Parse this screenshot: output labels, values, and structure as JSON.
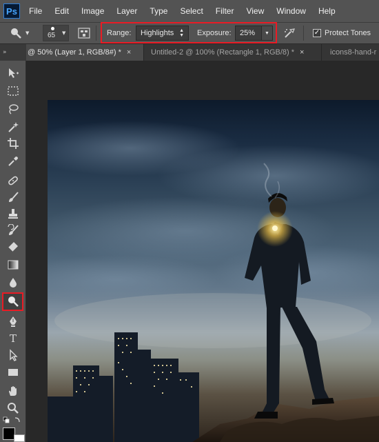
{
  "app": {
    "logo": "Ps"
  },
  "menu": [
    "File",
    "Edit",
    "Image",
    "Layer",
    "Type",
    "Select",
    "Filter",
    "View",
    "Window",
    "Help"
  ],
  "options": {
    "brush_size": "65",
    "range_label": "Range:",
    "range_value": "Highlights",
    "exposure_label": "Exposure:",
    "exposure_value": "25%",
    "protect_tones_label": "Protect Tones",
    "protect_tones_checked": true
  },
  "tabs": [
    {
      "label": "@ 50% (Layer 1, RGB/8#) *",
      "active": true
    },
    {
      "label": "Untitled-2 @ 100% (Rectangle 1, RGB/8) *",
      "active": false
    },
    {
      "label": "icons8-hand-r",
      "active": false
    }
  ],
  "panel": {
    "collapse_glyph": "»"
  },
  "tools": [
    "move",
    "marquee",
    "lasso",
    "magic-wand",
    "crop",
    "eyedropper",
    "healing-brush",
    "brush",
    "clone-stamp",
    "history-brush",
    "eraser",
    "gradient",
    "blur",
    "dodge",
    "pen",
    "type",
    "path-selection",
    "rectangle",
    "hand",
    "zoom"
  ],
  "selected_tool": "dodge",
  "colors": {
    "accent_red": "#ea1b24",
    "ps_blue": "#46a5ff",
    "panel_bg": "#535353",
    "canvas_bg": "#282828"
  }
}
